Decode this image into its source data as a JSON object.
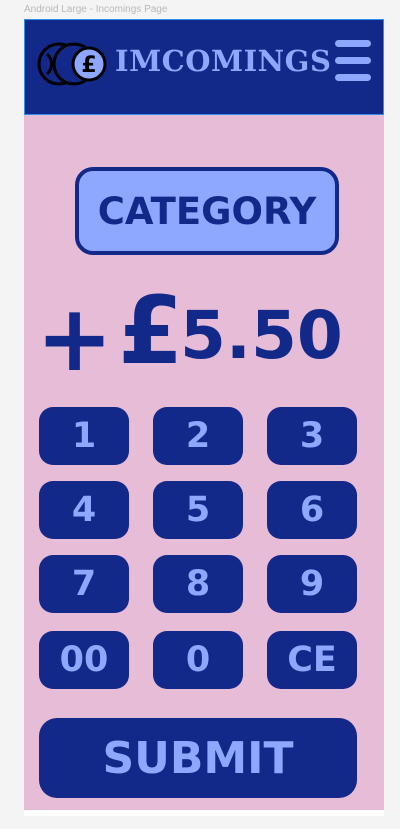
{
  "frame_label": "Android Large - Incomings Page",
  "header": {
    "logo_icon": "coins-pound-icon",
    "title": "IMCOMINGS",
    "menu_icon": "hamburger-menu-icon"
  },
  "category_button": {
    "label": "CATEGORY"
  },
  "amount": {
    "sign": "+",
    "currency": "£",
    "value": "5.50"
  },
  "keypad": {
    "keys": [
      "1",
      "2",
      "3",
      "4",
      "5",
      "6",
      "7",
      "8",
      "9",
      "00",
      "0",
      "CE"
    ]
  },
  "submit_button": {
    "label": "SUBMIT"
  },
  "colors": {
    "navy": "#13298a",
    "periwinkle": "#8ea8ff",
    "pink_background": "#e6bcd7"
  }
}
